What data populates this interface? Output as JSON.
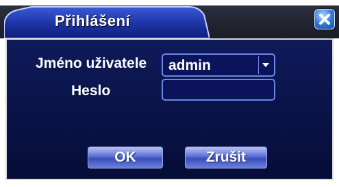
{
  "dialog": {
    "title": "Přihlášení"
  },
  "form": {
    "username_label": "Jméno uživatele",
    "username_value": "admin",
    "password_label": "Heslo",
    "password_value": ""
  },
  "buttons": {
    "ok_label": "OK",
    "cancel_label": "Zrušit"
  },
  "icons": {
    "close": "close-icon",
    "dropdown": "chevron-down-icon"
  },
  "colors": {
    "panel_bg": "#091245",
    "field_border": "#6e86e8",
    "button": "#5a6ed6",
    "close_button": "#2c73d9"
  }
}
